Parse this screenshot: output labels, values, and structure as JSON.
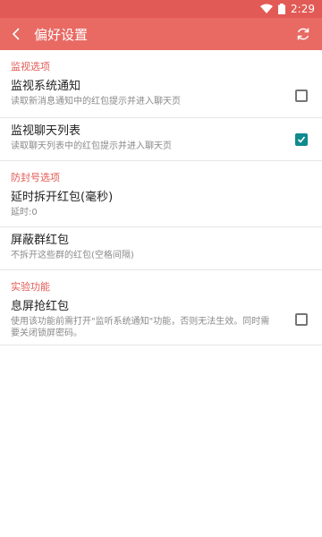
{
  "status": {
    "time": "2:29"
  },
  "toolbar": {
    "title": "偏好设置"
  },
  "sections": {
    "monitor": {
      "header": "监视选项",
      "items": [
        {
          "title": "监视系统通知",
          "summary": "读取新消息通知中的红包提示并进入聊天页",
          "checked": false
        },
        {
          "title": "监视聊天列表",
          "summary": "读取聊天列表中的红包提示并进入聊天页",
          "checked": true
        }
      ]
    },
    "anti": {
      "header": "防封号选项",
      "items": [
        {
          "title": "延时拆开红包(毫秒)",
          "summary": "延时:0"
        },
        {
          "title": "屏蔽群红包",
          "summary": "不拆开这些群的红包(空格间隔)"
        }
      ]
    },
    "exp": {
      "header": "实验功能",
      "items": [
        {
          "title": "息屏抢红包",
          "summary": "使用该功能前需打开\"监听系统通知\"功能，否则无法生效。同时需要关闭锁屏密码。",
          "checked": false
        }
      ]
    }
  },
  "colors": {
    "accent": "#e25a55",
    "toolbar": "#e86a63",
    "checkbox_on": "#0f8a8f"
  }
}
